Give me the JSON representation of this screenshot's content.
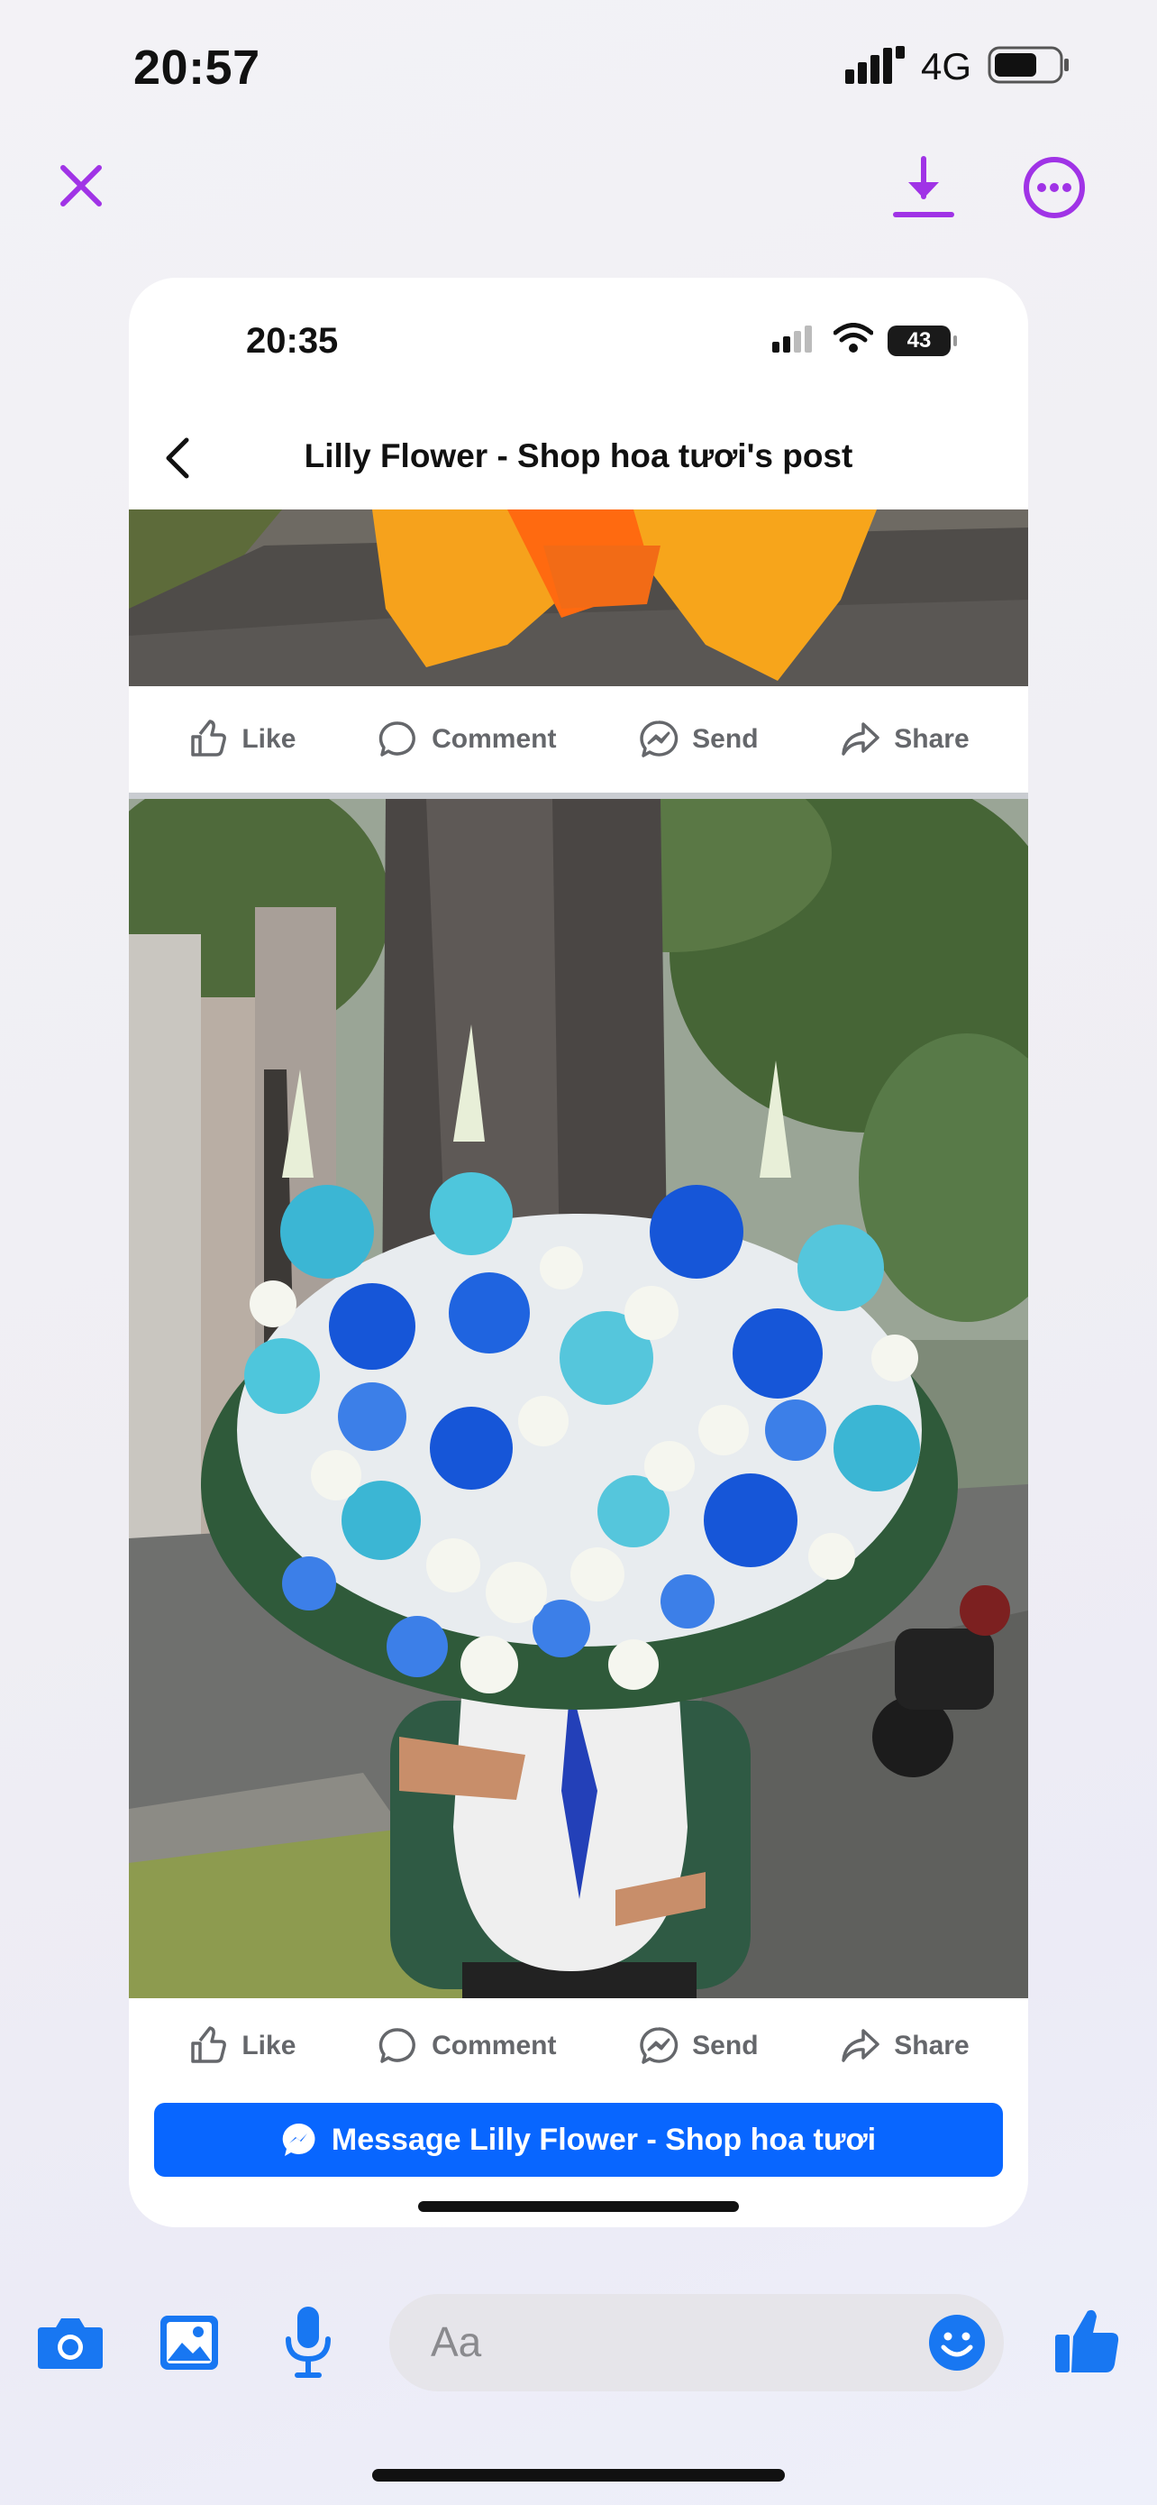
{
  "status_bar": {
    "time": "20:57",
    "network": "4G"
  },
  "viewer": {
    "close_icon": "close-icon",
    "download_icon": "download-icon",
    "more_icon": "more-icon",
    "accent_color": "#a033e6"
  },
  "screenshot": {
    "status_bar": {
      "time": "20:35",
      "battery": "43"
    },
    "header": {
      "title": "Lilly Flower - Shop hoa tươi's post"
    },
    "actions": [
      {
        "label": "Like",
        "icon": "like-icon"
      },
      {
        "label": "Comment",
        "icon": "comment-icon"
      },
      {
        "label": "Send",
        "icon": "messenger-icon"
      },
      {
        "label": "Share",
        "icon": "share-icon"
      }
    ],
    "message_button": {
      "label": "Message Lilly Flower - Shop hoa tươi",
      "color": "#0866ff"
    }
  },
  "composer": {
    "placeholder": "Aa",
    "accent_color": "#1877f2"
  }
}
